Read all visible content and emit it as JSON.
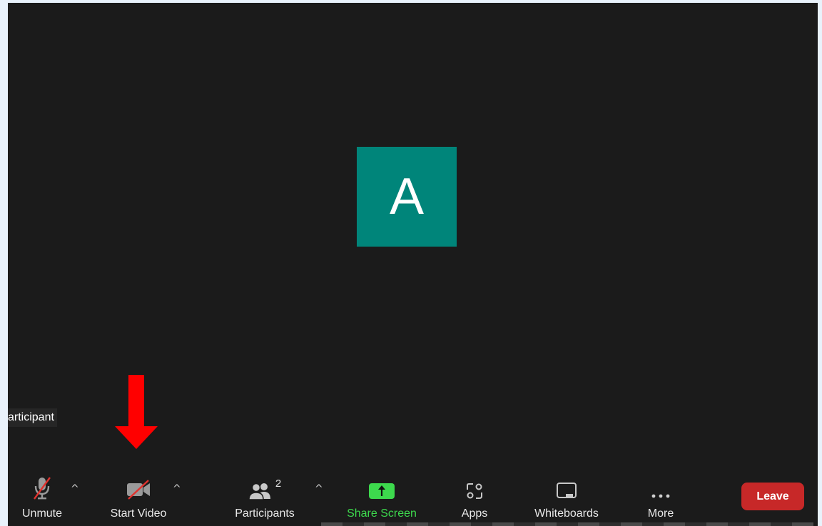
{
  "avatar": {
    "initial": "A",
    "color": "#00857a"
  },
  "name_label": "articipant",
  "toolbar": {
    "unmute_label": "Unmute",
    "start_video_label": "Start Video",
    "participants_label": "Participants",
    "participants_count": "2",
    "share_screen_label": "Share Screen",
    "apps_label": "Apps",
    "whiteboards_label": "Whiteboards",
    "more_label": "More",
    "leave_label": "Leave",
    "caret": "^"
  },
  "colors": {
    "background": "#1b1b1b",
    "leave": "#c72828",
    "share_screen": "#3dd94d",
    "annotation_arrow": "#ff0000"
  }
}
